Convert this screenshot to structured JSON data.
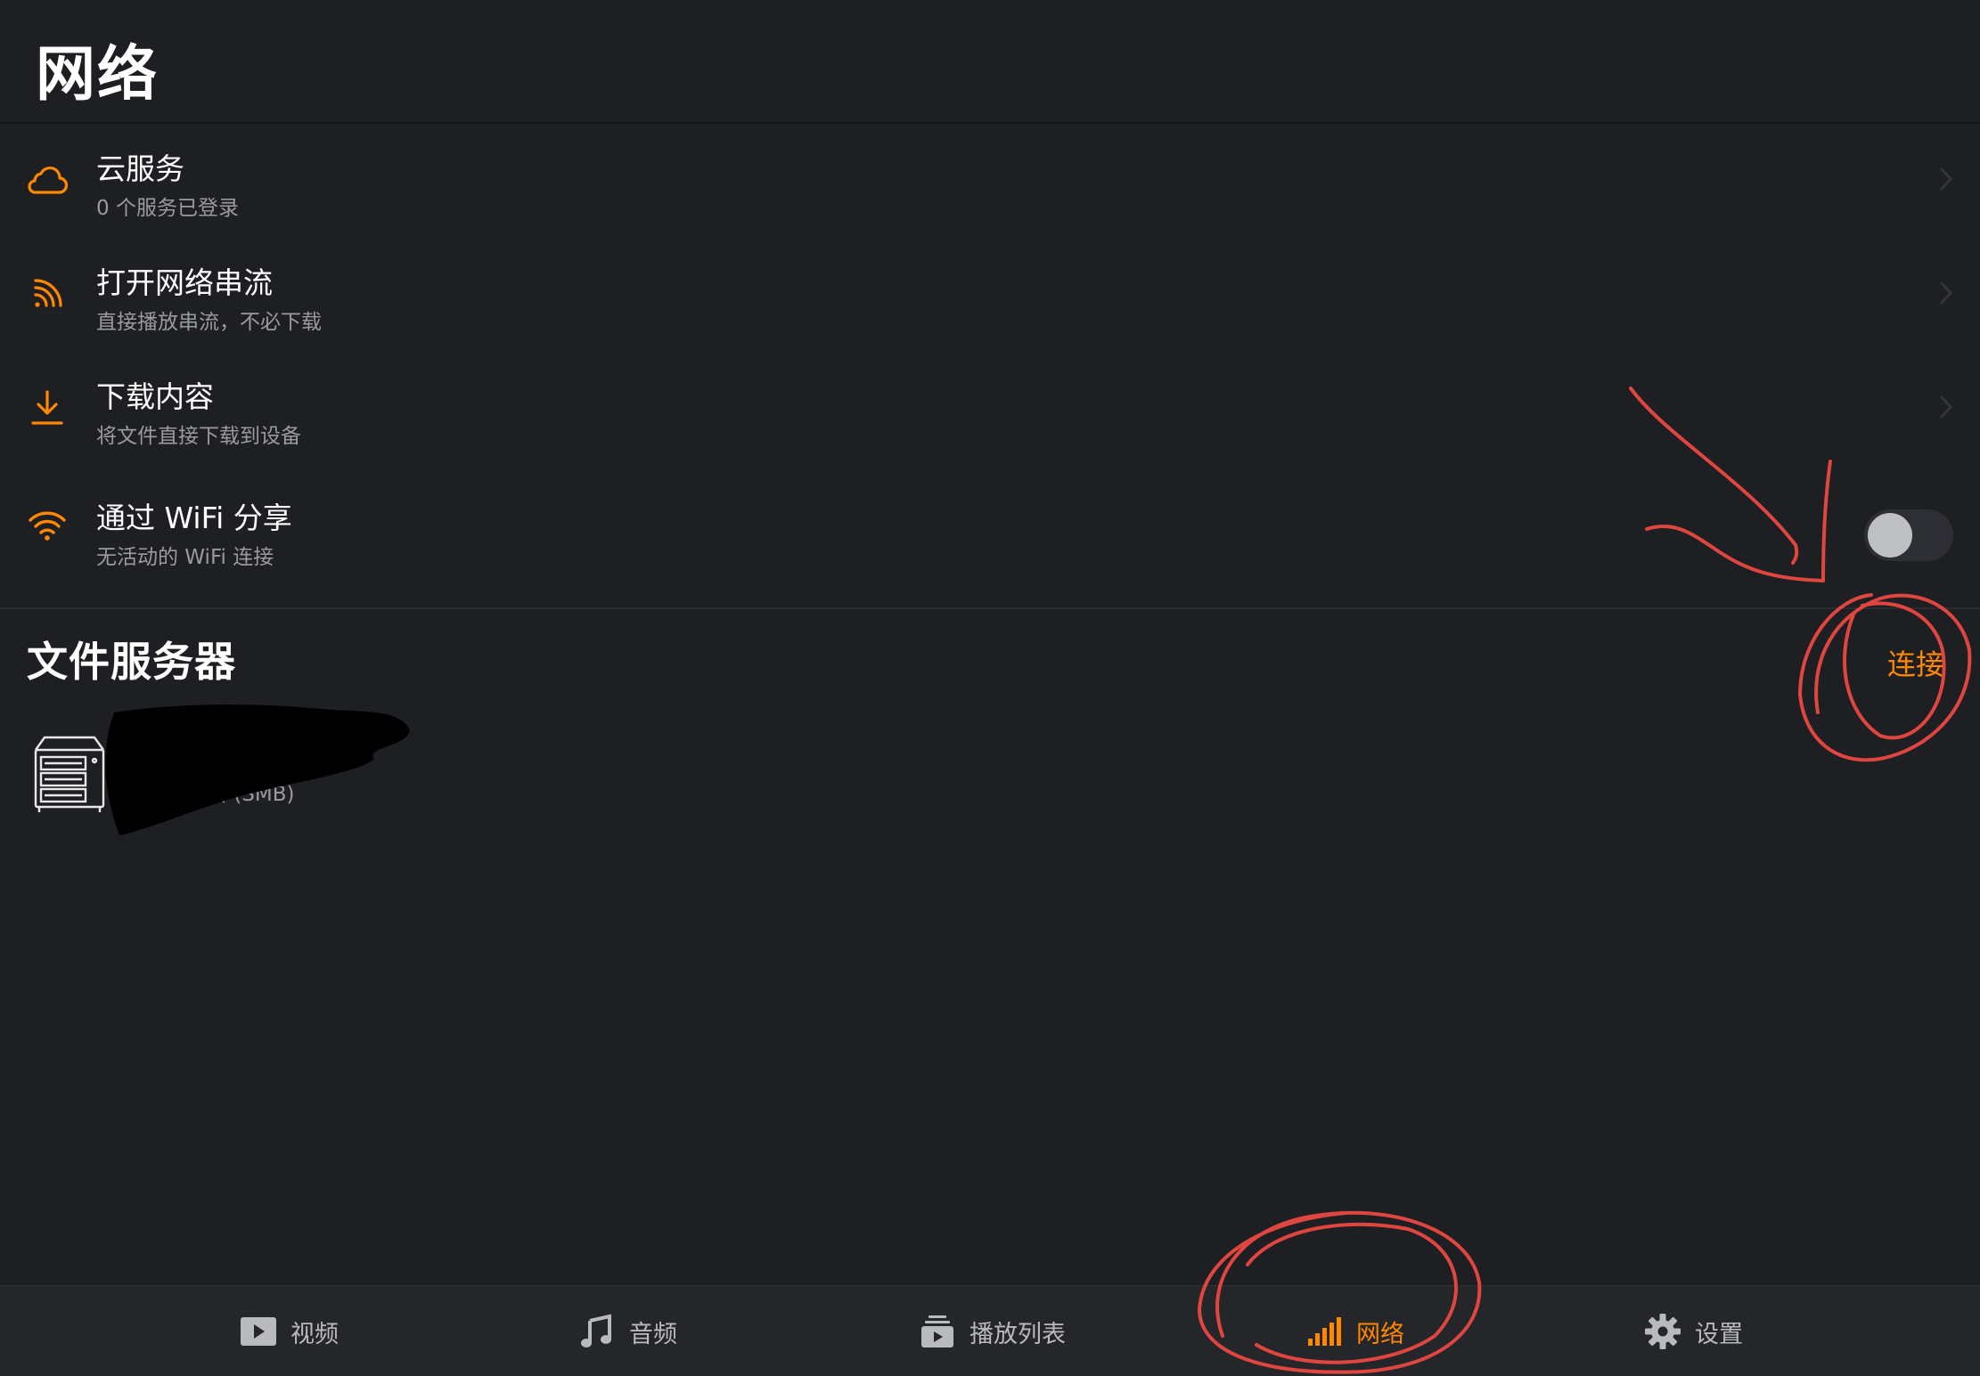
{
  "header": {
    "title": "网络"
  },
  "menu": {
    "items": [
      {
        "title": "云服务",
        "subtitle": "0 个服务已登录",
        "icon": "cloud-icon"
      },
      {
        "title": "打开网络串流",
        "subtitle": "直接播放串流，不必下载",
        "icon": "rss-icon"
      },
      {
        "title": "下载内容",
        "subtitle": "将文件直接下载到设备",
        "icon": "download-icon"
      },
      {
        "title": "通过 WiFi 分享",
        "subtitle": "无活动的 WiFi 连接",
        "icon": "wifi-icon",
        "toggle_on": false
      }
    ]
  },
  "file_servers": {
    "title": "文件服务器",
    "connect_label": "连接",
    "servers": [
      {
        "type_label": "文件服务器 (SMB)",
        "icon": "server-icon"
      }
    ]
  },
  "tabbar": {
    "tabs": [
      {
        "label": "视频",
        "icon": "video-icon",
        "active": false
      },
      {
        "label": "音频",
        "icon": "music-note-icon",
        "active": false
      },
      {
        "label": "播放列表",
        "icon": "playlist-icon",
        "active": false
      },
      {
        "label": "网络",
        "icon": "network-bars-icon",
        "active": true
      },
      {
        "label": "设置",
        "icon": "gear-icon",
        "active": false
      }
    ]
  },
  "colors": {
    "accent": "#ff8800",
    "background": "#1e1f23",
    "tabbar_background": "#25262a",
    "subtitle": "#9a9ba0",
    "annotation_ink": "#e0463f"
  }
}
